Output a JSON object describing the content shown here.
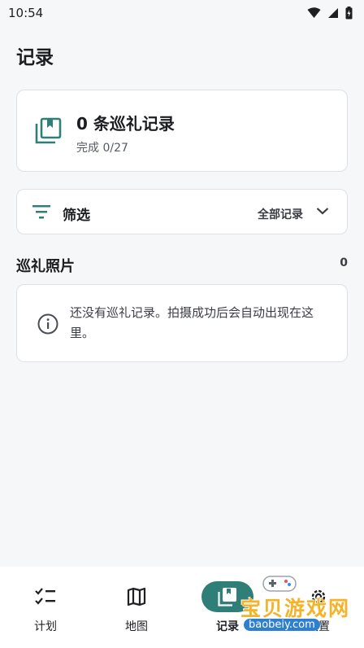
{
  "status_bar": {
    "time": "10:54"
  },
  "page": {
    "title": "记录"
  },
  "summary": {
    "title": "0 条巡礼记录",
    "subtitle": "完成 0/27"
  },
  "filter": {
    "label": "筛选",
    "value": "全部记录"
  },
  "photos": {
    "title": "巡礼照片",
    "count": "0",
    "empty_message": "还没有巡礼记录。拍摄成功后会自动出现在这里。"
  },
  "nav": {
    "items": [
      {
        "label": "计划",
        "icon": "checklist-icon"
      },
      {
        "label": "地图",
        "icon": "map-icon"
      },
      {
        "label": "记录",
        "icon": "library-icon",
        "active": true
      },
      {
        "label": "设置",
        "icon": "gear-icon"
      }
    ]
  },
  "watermark": {
    "text": "宝贝游戏网",
    "url": "baobeiy.com"
  },
  "colors": {
    "accent": "#2f7f78",
    "background": "#f6f7f9",
    "card": "#ffffff"
  }
}
